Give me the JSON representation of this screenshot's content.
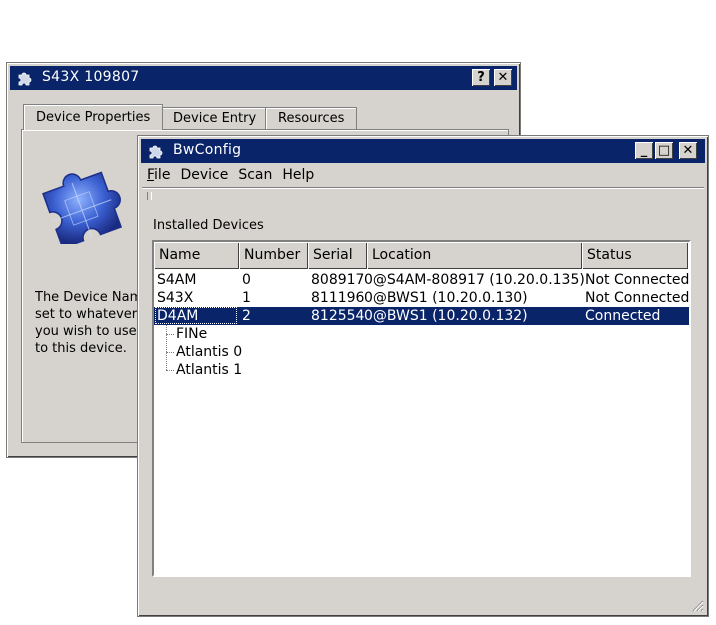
{
  "back_window": {
    "title": "S43X 109807",
    "buttons": {
      "help": "?",
      "close": "✕"
    },
    "tabs": [
      {
        "label": "Device Properties",
        "active": true
      },
      {
        "label": "Device Entry",
        "active": false
      },
      {
        "label": "Resources",
        "active": false
      }
    ],
    "description": "The Device Name\nset to whatever s\nyou wish to use t\nto this device."
  },
  "front_window": {
    "title": "BwConfig",
    "buttons": {
      "minimize": "_",
      "maximize": "□",
      "close": "✕"
    },
    "menu": [
      "File",
      "Device",
      "Scan",
      "Help"
    ],
    "section_label": "Installed Devices",
    "columns": [
      "Name",
      "Number",
      "Serial",
      "Location",
      "Status"
    ],
    "rows": [
      {
        "name": "S4AM",
        "number": "0",
        "serial": "808917",
        "location": "0@S4AM-808917 (10.20.0.135)",
        "status": "Not Connected",
        "selected": false
      },
      {
        "name": "S43X",
        "number": "1",
        "serial": "811196",
        "location": "0@BWS1 (10.20.0.130)",
        "status": "Not Connected",
        "selected": false
      },
      {
        "name": "D4AM",
        "number": "2",
        "serial": "812554",
        "location": "0@BWS1 (10.20.0.132)",
        "status": "Connected",
        "selected": true
      }
    ],
    "children": [
      "FINe",
      "Atlantis 0",
      "Atlantis 1"
    ]
  },
  "colors": {
    "titlebar": "#0a246a",
    "window": "#d6d3ce",
    "selection": "#0a246a"
  },
  "icons": [
    "puzzle-app-icon",
    "puzzle-illustration",
    "resize-grip-icon"
  ]
}
